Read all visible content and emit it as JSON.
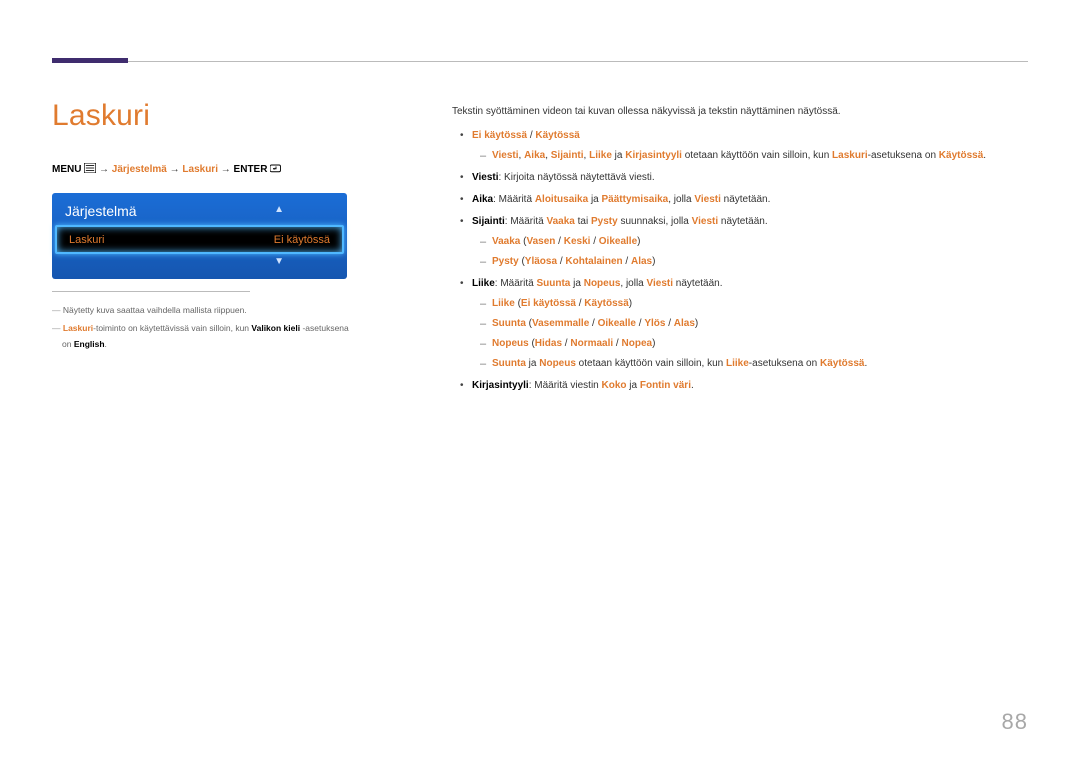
{
  "heading": "Laskuri",
  "breadcrumb": {
    "menu": "MENU",
    "arrow": " → ",
    "p1": "Järjestelmä",
    "p2": "Laskuri",
    "p3": "ENTER"
  },
  "osd": {
    "title": "Järjestelmä",
    "row_label": "Laskuri",
    "row_value": "Ei käytössä"
  },
  "footnotes": {
    "f1": "Näytetty kuva saattaa vaihdella mallista riippuen.",
    "f2a": "Laskuri",
    "f2b": "-toiminto on käytettävissä vain silloin, kun ",
    "f2c": "Valikon kieli",
    "f2d": " -asetuksena on ",
    "f2e": "English",
    "f2f": "."
  },
  "right": {
    "intro": "Tekstin syöttäminen videon tai kuvan ollessa näkyvissä ja tekstin näyttäminen näytössä.",
    "b1a": "Ei käytössä",
    "b1sep": " / ",
    "b1b": "Käytössä",
    "b1d1a": "Viesti",
    "b1d1b": "Aika",
    "b1d1c": "Sijainti",
    "b1d1d": "Liike",
    "b1d1e": " ja ",
    "b1d1f": "Kirjasintyyli",
    "b1d1g": " otetaan käyttöön vain silloin, kun ",
    "b1d1h": "Laskuri",
    "b1d1i": "-asetuksena on ",
    "b1d1j": "Käytössä",
    "b1d1k": ".",
    "b2a": "Viesti",
    "b2b": ": Kirjoita näytössä näytettävä viesti.",
    "b3a": "Aika",
    "b3b": ": Määritä ",
    "b3c": "Aloitusaika",
    "b3d": " ja ",
    "b3e": "Päättymisaika",
    "b3f": ", jolla ",
    "b3g": "Viesti",
    "b3h": " näytetään.",
    "b4a": "Sijainti",
    "b4b": ": Määritä ",
    "b4c": "Vaaka",
    "b4d": " tai ",
    "b4e": "Pysty",
    "b4f": " suunnaksi, jolla ",
    "b4g": "Viesti",
    "b4h": " näytetään.",
    "b4d1a": "Vaaka",
    "b4d1b": " (",
    "b4d1c": "Vasen",
    "b4d1d": " / ",
    "b4d1e": "Keski",
    "b4d1f": " / ",
    "b4d1g": "Oikealle",
    "b4d1h": ")",
    "b4d2a": "Pysty",
    "b4d2b": " (",
    "b4d2c": "Yläosa",
    "b4d2d": " / ",
    "b4d2e": "Kohtalainen",
    "b4d2f": " / ",
    "b4d2g": "Alas",
    "b4d2h": ")",
    "b5a": "Liike",
    "b5b": ": Määritä ",
    "b5c": "Suunta",
    "b5d": " ja ",
    "b5e": "Nopeus",
    "b5f": ", jolla ",
    "b5g": "Viesti",
    "b5h": " näytetään.",
    "b5d1a": "Liike",
    "b5d1b": " (",
    "b5d1c": "Ei käytössä",
    "b5d1d": " / ",
    "b5d1e": "Käytössä",
    "b5d1f": ")",
    "b5d2a": "Suunta",
    "b5d2b": " (",
    "b5d2c": "Vasemmalle",
    "b5d2d": " / ",
    "b5d2e": "Oikealle",
    "b5d2f": " / ",
    "b5d2g": "Ylös",
    "b5d2h": " / ",
    "b5d2i": "Alas",
    "b5d2j": ")",
    "b5d3a": "Nopeus",
    "b5d3b": " (",
    "b5d3c": "Hidas",
    "b5d3d": " / ",
    "b5d3e": "Normaali",
    "b5d3f": " / ",
    "b5d3g": "Nopea",
    "b5d3h": ")",
    "b5d4a": "Suunta",
    "b5d4b": " ja ",
    "b5d4c": "Nopeus",
    "b5d4d": " otetaan käyttöön vain silloin, kun ",
    "b5d4e": "Liike",
    "b5d4f": "-asetuksena on ",
    "b5d4g": "Käytössä",
    "b5d4h": ".",
    "b6a": "Kirjasintyyli",
    "b6b": ": Määritä viestin ",
    "b6c": "Koko",
    "b6d": " ja ",
    "b6e": "Fontin väri",
    "b6f": "."
  },
  "page_number": "88"
}
